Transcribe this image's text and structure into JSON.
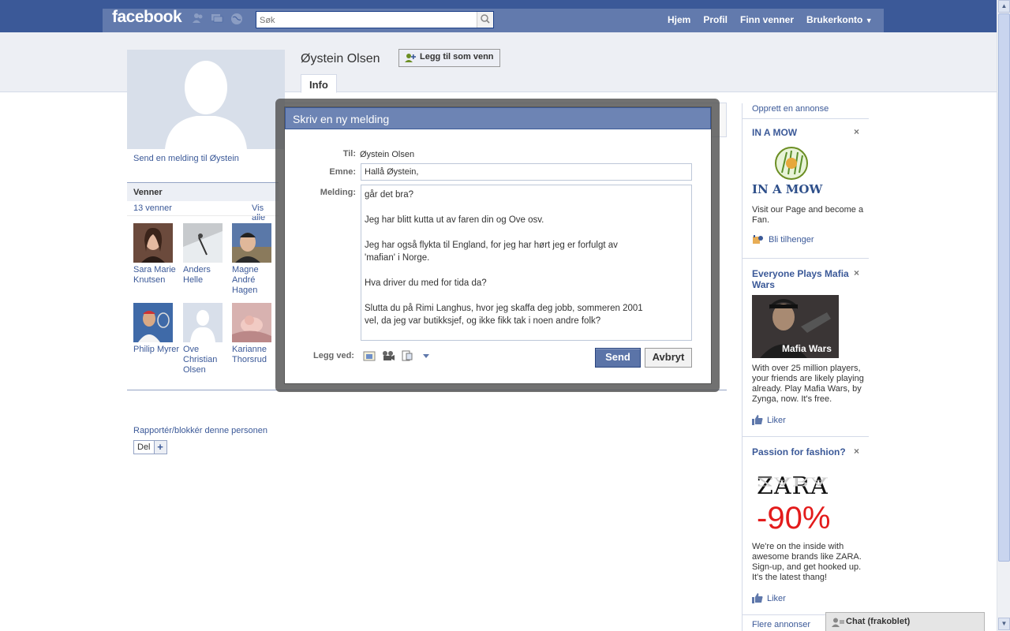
{
  "topbar": {
    "logo": "facebook",
    "search_placeholder": "Søk",
    "nav": [
      "Hjem",
      "Profil",
      "Finn venner",
      "Brukerkonto"
    ]
  },
  "profile": {
    "name": "Øystein Olsen",
    "add_friend_label": "Legg til som venn",
    "send_message_link": "Send en melding til Øystein",
    "tab": "Info",
    "report_link": "Rapportér/blokkér denne personen",
    "share_label": "Del",
    "share_plus": "+"
  },
  "friends": {
    "title": "Venner",
    "count": "13 venner",
    "see_all": "Vis alle",
    "list": [
      {
        "name": "Sara Marie Knutsen",
        "color": "#6b4a3c"
      },
      {
        "name": "Anders Helle",
        "color": "#9fa4a7"
      },
      {
        "name": "Magne André Hagen",
        "color": "#7a8b6c"
      },
      {
        "name": "Philip Myrer",
        "color": "#4b6fa6"
      },
      {
        "name": "Ove Christian Olsen",
        "color": "#d8dfea"
      },
      {
        "name": "Karianne Thorsrud",
        "color": "#c79b99"
      }
    ]
  },
  "dialog": {
    "title": "Skriv en ny melding",
    "to_label": "Til:",
    "to_value": "Øystein Olsen",
    "subject_label": "Emne:",
    "subject_value": "Hallå Øystein,",
    "message_label": "Melding:",
    "message_lines": [
      "går det bra?",
      "",
      "Jeg har blitt kutta ut av faren din og Ove osv.",
      "",
      "Jeg har også flykta til England, for jeg har hørt jeg er forfulgt av",
      "'mafian' i Norge.",
      "",
      "Hva driver du med for tida da?",
      "",
      "Slutta du på Rimi Langhus, hvor jeg skaffa deg jobb, sommeren 2001",
      "vel, da jeg var butikksjef, og ikke fikk tak i noen andre folk?"
    ],
    "attach_label": "Legg ved:",
    "send_label": "Send",
    "cancel_label": "Avbryt"
  },
  "ads": {
    "create_ad": "Opprett en annonse",
    "items": [
      {
        "title": "IN A MOW",
        "logo_text": "IN A MOW",
        "text": "Visit our Page and become a Fan.",
        "action": "Bli tilhenger"
      },
      {
        "title": "Everyone Plays Mafia Wars",
        "image_text": "Mafia Wars",
        "text": "With over 25 million players, your friends are likely playing already. Play Mafia Wars, by Zynga, now. It's free.",
        "action": "Liker"
      },
      {
        "title": "Passion for fashion?",
        "brand": "ZARA",
        "discount": "-90%",
        "text": "We're on the inside with awesome brands like ZARA. Sign-up, and get hooked up. It's the latest thang!",
        "action": "Liker"
      }
    ],
    "close_symbol": "×",
    "more_ads": "Flere annonser"
  },
  "chat": {
    "label": "Chat (frakoblet)"
  },
  "colors": {
    "brand": "#3b5998",
    "dialog_header": "#6d84b4",
    "send_button": "#5b74a8"
  }
}
